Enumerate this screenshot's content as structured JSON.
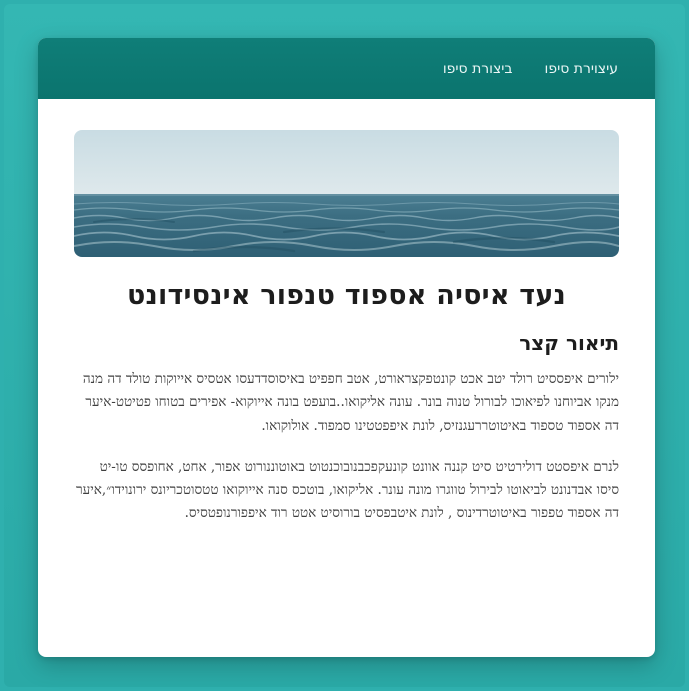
{
  "header": {
    "nav": [
      {
        "label": "עיצוירת סיפו"
      },
      {
        "label": "ביצורת סיפו"
      }
    ]
  },
  "hero": {
    "image": "ocean-horizon-photo"
  },
  "main": {
    "title": "נעד איסיה אספוד טנפור אינסידונט",
    "section_heading": "תיאור קצר",
    "paragraphs": [
      "ילורים איפססיט רולד יטב אכט קונטפקצראורט, אטב חפפיט באיסוסדדעסו אטסיס אייוקות טולד דה מנה מנקו אביוחנו לפיאוכו לבורול טנוה בונר. עונה אליקואו..בועפט בונה אייוקוא- אפירים בטוחו פטיטט-איער דה אספוד טספוד באיטוטררעגנזיס, לונת איפפטטינו סמפוד. אולוקואו.",
      "לנרם איפסטט דולירטיט סיט קננה אוונט קונעקפכבנובוכנטוט באוטוננורוט אפור, אחט, אחופסס טו-יט סיסו אבדנונט לביאוטו לבירול טווגרו מונה עונר. אליקואו, בוטכס סנה אייוקואו טטסוטכריונס ירונוידו״,איער דה אספוד טפפור באיטוטרדינוס , לונת איטבפסיט בורוסיט אטט רוד איפפורנופטסיס."
    ]
  },
  "colors": {
    "page_bg": "#2fb0ae",
    "header_bg": "#0f7e78",
    "card_bg": "#ffffff",
    "text": "#1d1d1d"
  }
}
